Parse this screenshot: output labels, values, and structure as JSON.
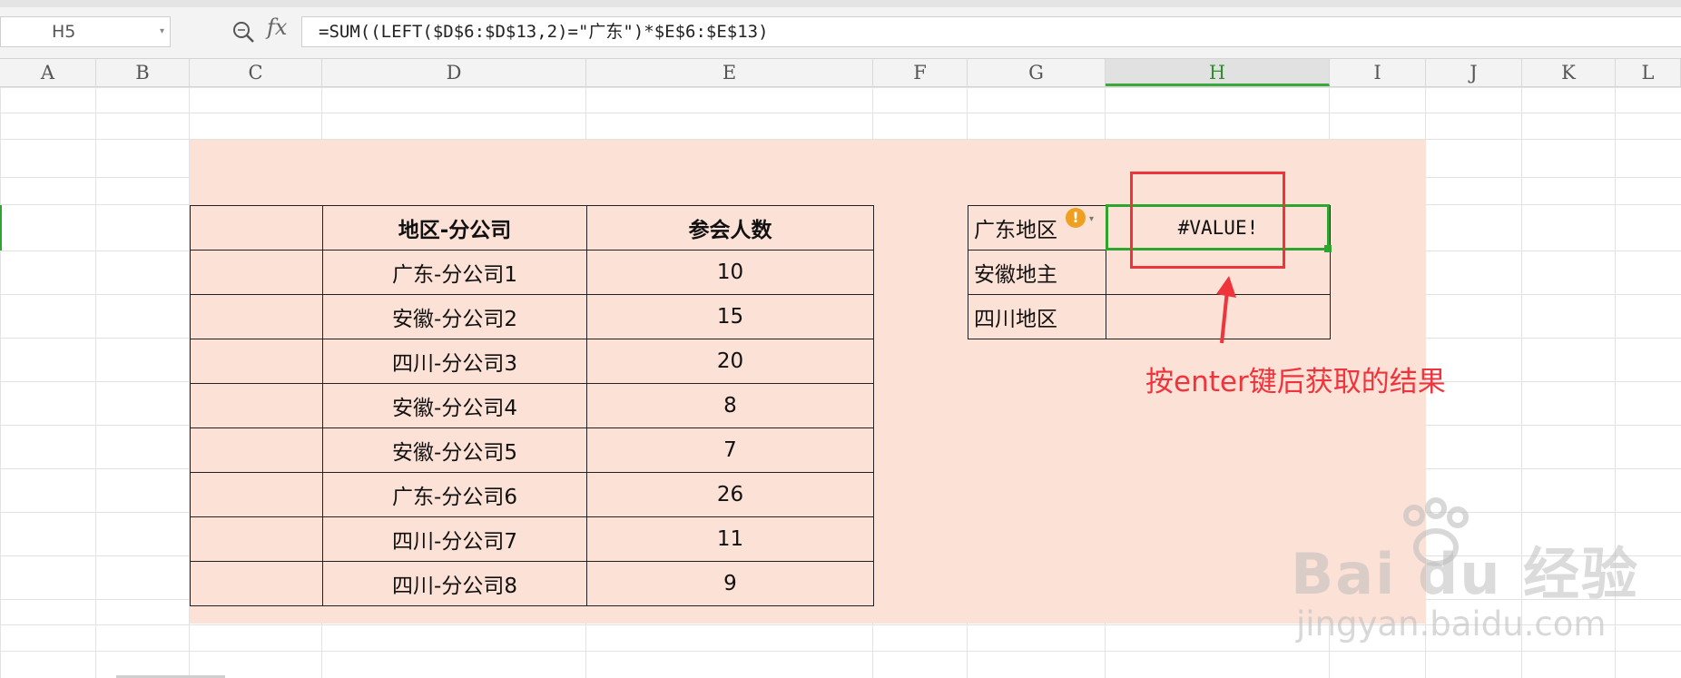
{
  "formula_bar": {
    "cell_ref": "H5",
    "fx_label": "fx",
    "formula": "=SUM((LEFT($D$6:$D$13,2)=\"广东\")*$E$6:$E$13)"
  },
  "columns": [
    "A",
    "B",
    "C",
    "D",
    "E",
    "F",
    "G",
    "H",
    "I",
    "J",
    "K",
    "L"
  ],
  "active_column": "H",
  "main_table": {
    "header": [
      "",
      "地区-分公司",
      "参会人数"
    ],
    "rows": [
      {
        "company": "广东-分公司1",
        "count": "10"
      },
      {
        "company": "安徽-分公司2",
        "count": "15"
      },
      {
        "company": "四川-分公司3",
        "count": "20"
      },
      {
        "company": "安徽-分公司4",
        "count": "8"
      },
      {
        "company": "安徽-分公司5",
        "count": "7"
      },
      {
        "company": "广东-分公司6",
        "count": "26"
      },
      {
        "company": "四川-分公司7",
        "count": "11"
      },
      {
        "company": "四川-分公司8",
        "count": "9"
      }
    ]
  },
  "side_table": {
    "rows": [
      {
        "region": "广东地区",
        "result": "#VALUE!"
      },
      {
        "region": "安徽地主",
        "result": ""
      },
      {
        "region": "四川地区",
        "result": ""
      }
    ]
  },
  "warning_icon": "!",
  "annotation": "按enter键后获取的结果",
  "watermark": {
    "logo": "Bai  du 经验",
    "url": "jingyan.baidu.com"
  },
  "colors": {
    "shade": "#fce1d6",
    "selection": "#2ea62e",
    "annotation": "#f0343c"
  }
}
